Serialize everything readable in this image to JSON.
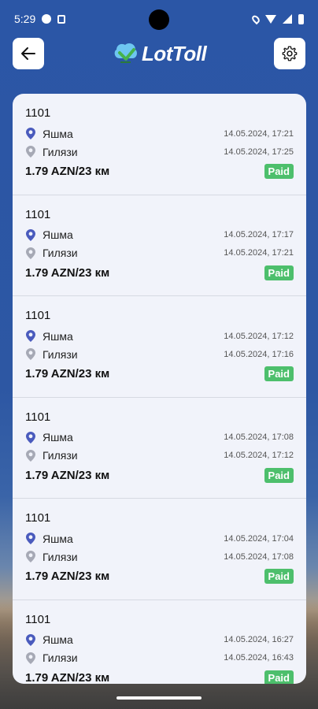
{
  "status_bar": {
    "time": "5:29"
  },
  "header": {
    "logo_text": "LotToll"
  },
  "trips": [
    {
      "id": "1101",
      "from": "Яшма",
      "from_time": "14.05.2024, 17:21",
      "to": "Гилязи",
      "to_time": "14.05.2024, 17:25",
      "price": "1.79 AZN/23 км",
      "status": "Paid"
    },
    {
      "id": "1101",
      "from": "Яшма",
      "from_time": "14.05.2024, 17:17",
      "to": "Гилязи",
      "to_time": "14.05.2024, 17:21",
      "price": "1.79 AZN/23 км",
      "status": "Paid"
    },
    {
      "id": "1101",
      "from": "Яшма",
      "from_time": "14.05.2024, 17:12",
      "to": "Гилязи",
      "to_time": "14.05.2024, 17:16",
      "price": "1.79 AZN/23 км",
      "status": "Paid"
    },
    {
      "id": "1101",
      "from": "Яшма",
      "from_time": "14.05.2024, 17:08",
      "to": "Гилязи",
      "to_time": "14.05.2024, 17:12",
      "price": "1.79 AZN/23 км",
      "status": "Paid"
    },
    {
      "id": "1101",
      "from": "Яшма",
      "from_time": "14.05.2024, 17:04",
      "to": "Гилязи",
      "to_time": "14.05.2024, 17:08",
      "price": "1.79 AZN/23 км",
      "status": "Paid"
    },
    {
      "id": "1101",
      "from": "Яшма",
      "from_time": "14.05.2024, 16:27",
      "to": "Гилязи",
      "to_time": "14.05.2024, 16:43",
      "price": "1.79 AZN/23 км",
      "status": "Paid"
    }
  ],
  "colors": {
    "header_bg": "#2b56a6",
    "paid_badge": "#4dbf6c",
    "pin_from": "#4a5bbd",
    "pin_to": "#a6a9b5"
  },
  "icons": {
    "back": "arrow-left-icon",
    "settings": "gear-icon",
    "from_pin": "location-pin-icon",
    "to_pin": "location-pin-outline-icon"
  }
}
